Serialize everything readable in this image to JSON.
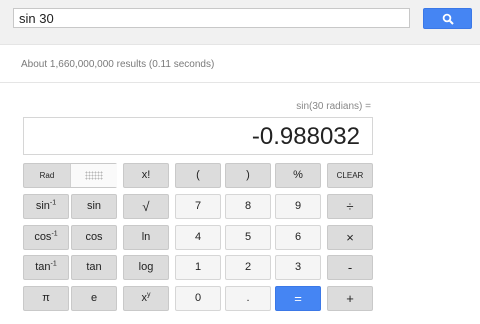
{
  "search": {
    "query": "sin 30",
    "button_icon": "search-icon",
    "results_stats": "About 1,660,000,000 results (0.11 seconds)"
  },
  "calculator": {
    "expression": "sin(30 radians) =",
    "result": "-0.988032",
    "colors": {
      "function_key": "#dcdcdc",
      "number_key": "#f5f5f5",
      "equals_key": "#4585f3"
    },
    "keys": {
      "rad": "Rad",
      "factorial": "x!",
      "open_paren": "(",
      "close_paren": ")",
      "percent": "%",
      "clear": "CLEAR",
      "asin_base": "sin",
      "asin_sup": "-1",
      "sin": "sin",
      "sqrt": "√",
      "n7": "7",
      "n8": "8",
      "n9": "9",
      "divide": "÷",
      "acos_base": "cos",
      "acos_sup": "-1",
      "cos": "cos",
      "ln": "ln",
      "n4": "4",
      "n5": "5",
      "n6": "6",
      "multiply": "×",
      "atan_base": "tan",
      "atan_sup": "-1",
      "tan": "tan",
      "log": "log",
      "n1": "1",
      "n2": "2",
      "n3": "3",
      "minus": "-",
      "pi": "π",
      "e": "e",
      "power_base": "x",
      "power_sup": "y",
      "n0": "0",
      "dot": ".",
      "equals": "=",
      "plus": "+"
    }
  }
}
